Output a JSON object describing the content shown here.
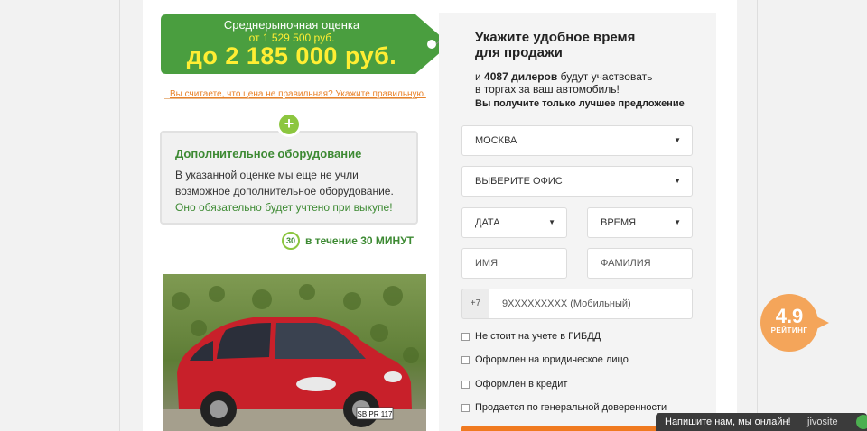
{
  "price": {
    "label": "Среднерыночная оценка",
    "from": "от 1 529 500 руб.",
    "to": "до 2 185 000 руб."
  },
  "wrong_price_link": "Вы считаете, что цена не правильная? Укажите правильную.",
  "equipment": {
    "title": "Дополнительное оборудование",
    "text": "В указанной оценке мы еще не учли возможное дополнительное оборудование.",
    "note": "Оно обязательно будет учтено при выкупе!"
  },
  "timer": {
    "icon_text": "30",
    "prefix": "в течение",
    "bold": "30 МИНУТ"
  },
  "form": {
    "title_line1": "Укажите удобное время",
    "title_line2": "для продажи",
    "dealers_prefix": "и",
    "dealers_count": "4087 дилеров",
    "dealers_suffix": "будут участвовать",
    "dealers_line2": "в торгах за ваш автомобиль!",
    "best_offer": "Вы получите только лучшее предложение",
    "city": "МОСКВА",
    "office": "ВЫБЕРИТЕ ОФИС",
    "date": "ДАТА",
    "time": "ВРЕМЯ",
    "first_name_placeholder": "ИМЯ",
    "last_name_placeholder": "ФАМИЛИЯ",
    "phone_prefix": "+7",
    "phone_placeholder": "9XXXXXXXXX (Мобильный)",
    "checkboxes": [
      "Не стоит на учете в ГИБДД",
      "Оформлен на юридическое лицо",
      "Оформлен в кредит",
      "Продается по генеральной доверенности"
    ]
  },
  "car_plate": "SB PR 117",
  "rating": {
    "value": "4.9",
    "label": "РЕЙТИНГ"
  },
  "chat": {
    "text": "Напишите нам, мы онлайн!",
    "brand": "jivosite"
  },
  "colors": {
    "green": "#4a9e3f",
    "orange": "#f07a20",
    "yellow": "#ffee33"
  }
}
